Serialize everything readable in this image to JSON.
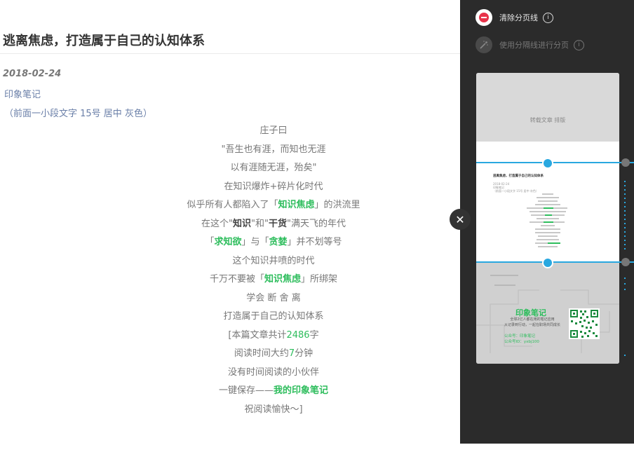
{
  "article": {
    "title": "逃离焦虑，打造属于自己的认知体系",
    "date": "2018-02-24",
    "source": "印象笔记",
    "note": "（前面一小段文字 15号 居中 灰色）",
    "lines": {
      "l1": "庄子曰",
      "l2": "\"吾生也有涯，而知也无涯",
      "l3": "以有涯随无涯，殆矣\"",
      "l4": "在知识爆炸+碎片化时代",
      "l5a": "似乎所有人都陷入了「",
      "l5b": "知识焦虑",
      "l5c": "」的洪流里",
      "l6a": "在这个\"",
      "l6b": "知识",
      "l6c": "\"和\"",
      "l6d": "干货",
      "l6e": "\"满天飞的年代",
      "l7a": "「",
      "l7b": "求知欲",
      "l7c": "」与「",
      "l7d": "贪婪",
      "l7e": "」并不划等号",
      "l8": "这个知识井喷的时代",
      "l9a": "千万不要被「",
      "l9b": "知识焦虑",
      "l9c": "」所绑架",
      "l10": "学会 断 舍 离",
      "l11": "打造属于自己的认知体系",
      "l12a": "[本篇文章共计",
      "l12b": "2486",
      "l12c": "字",
      "l13a": "阅读时间大约",
      "l13b": "7",
      "l13c": "分钟",
      "l14": "没有时间阅读的小伙伴",
      "l15a": "一键保存——",
      "l15b": "我的印象笔记",
      "l16": "祝阅读愉快～]"
    }
  },
  "sidebar": {
    "clear_label": "清除分页线",
    "use_label": "使用分隔线进行分页",
    "info_glyph": "i",
    "close_glyph": "✕"
  },
  "preview": {
    "top_label": "转载文章 排版",
    "mini_title": "逃离焦虑，打造属于自己的认知体系",
    "mini_date": "2018-02-24",
    "mini_source": "印象笔记",
    "mini_note": "（前面一小段文字 15号 居中 灰色）",
    "yx_title": "印象笔记",
    "yx_sub1": "全球2亿人都在用的笔记应用",
    "yx_sub2": "从记录到行动，一起在职场共同成长",
    "yx_acct1": "公众号：印象笔记",
    "yx_acct2": "公众号ID：yxbj100"
  },
  "colors": {
    "accent_green": "#2dbd5c",
    "divider_blue": "#29a8e0",
    "clear_icon_red": "#e8334a",
    "sidebar_bg": "#2b2b2b"
  }
}
